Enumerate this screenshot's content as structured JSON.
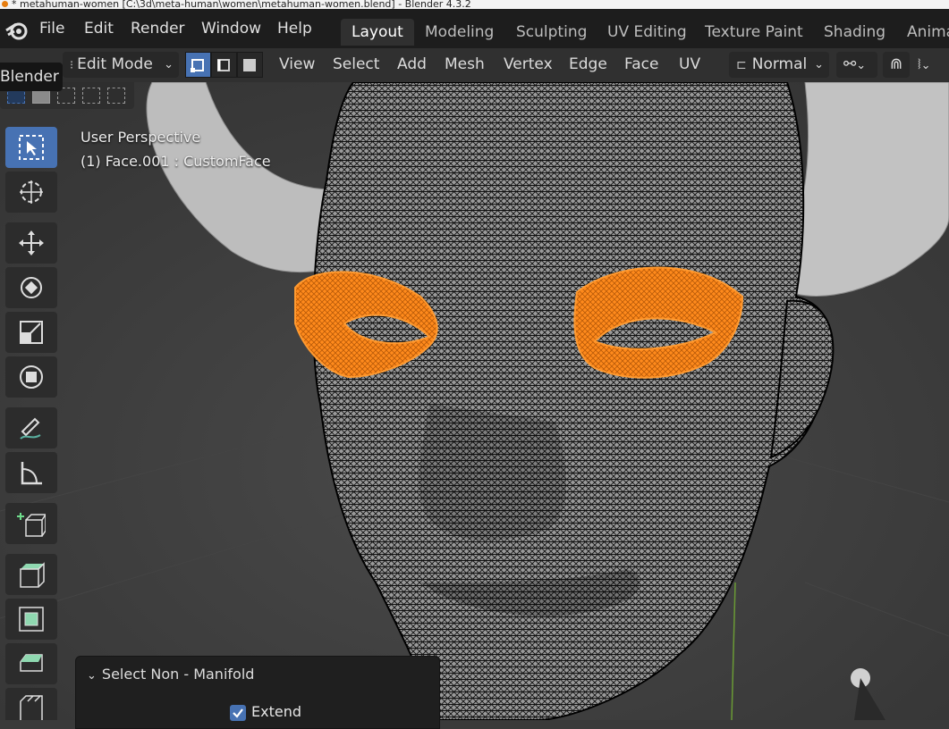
{
  "window": {
    "title": "* metahuman-women [C:\\3d\\meta-human\\women\\metahuman-women.blend] - Blender 4.3.2"
  },
  "menubar": {
    "items": [
      "File",
      "Edit",
      "Render",
      "Window",
      "Help"
    ]
  },
  "workspaces": {
    "tabs": [
      "Layout",
      "Modeling",
      "Sculpting",
      "UV Editing",
      "Texture Paint",
      "Shading",
      "Anima"
    ],
    "active": "Layout"
  },
  "header": {
    "mode": "Edit Mode",
    "menus": [
      "View",
      "Select",
      "Add",
      "Mesh",
      "Vertex",
      "Edge",
      "Face",
      "UV"
    ],
    "orientation": "Normal"
  },
  "tooltip": {
    "text": "Blender"
  },
  "viewport": {
    "view_name": "User Perspective",
    "object_info": "(1) Face.001 : CustomFace"
  },
  "operator_panel": {
    "title": "Select Non - Manifold",
    "extend_label": "Extend",
    "extend_checked": true
  },
  "colors": {
    "accent": "#4772b3",
    "selection": "#ff8a1c",
    "background": "#3b3b3b"
  },
  "icons": [
    "blender-logo-icon",
    "select-box-icon",
    "cursor-icon",
    "move-icon",
    "rotate-icon",
    "scale-icon",
    "transform-icon",
    "annotate-icon",
    "measure-icon",
    "add-cube-icon",
    "extrude-icon",
    "inset-icon",
    "bevel-icon",
    "loop-cut-icon"
  ]
}
